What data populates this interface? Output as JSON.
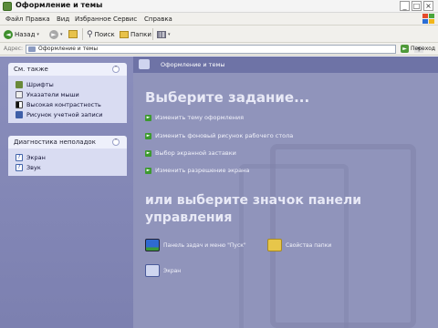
{
  "window": {
    "title": "Оформление и темы",
    "minimize": "_",
    "maximize": "□",
    "close": "×"
  },
  "menu": {
    "items": [
      "Файл",
      "Правка",
      "Вид",
      "Избранное",
      "Сервис",
      "Справка"
    ]
  },
  "toolbar": {
    "back_label": "Назад",
    "search_label": "Поиск",
    "folders_label": "Папки"
  },
  "address": {
    "label": "Адрес:",
    "value": "Оформление и темы",
    "go_label": "Переход"
  },
  "sidebar": {
    "see_also": {
      "title": "См. также",
      "items": [
        "Шрифты",
        "Указатели мыши",
        "Высокая контрастность",
        "Рисунок учетной записи"
      ]
    },
    "troubleshooting": {
      "title": "Диагностика неполадок",
      "items": [
        "Экран",
        "Звук"
      ]
    }
  },
  "content": {
    "header_title": "Оформление и темы",
    "pick_task": "Выберите задание...",
    "tasks": [
      "Изменить тему оформления",
      "Изменить фоновый рисунок рабочего стола",
      "Выбор экранной заставки",
      "Изменить разрешение экрана"
    ],
    "or_pick": "или выберите значок панели управления",
    "icons": [
      {
        "label": "Панель задач и меню \"Пуск\""
      },
      {
        "label": "Свойства папки"
      },
      {
        "label": "Экран"
      }
    ]
  },
  "colors": {
    "main_bg": "#9094bb",
    "sidebar_bg": "#8a8ebc",
    "header_bg": "#6e73a6",
    "task_arrow": "#3c9a2e"
  }
}
